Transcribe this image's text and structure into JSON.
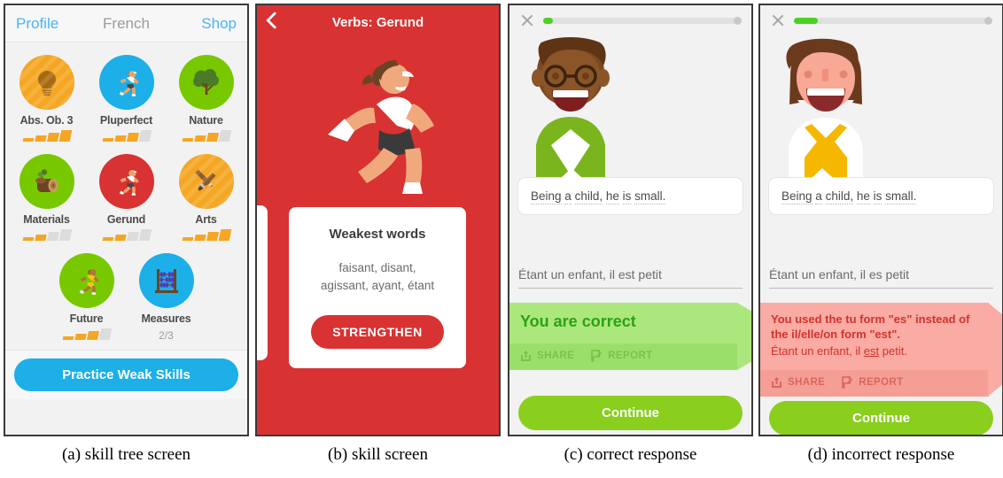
{
  "figure": {
    "captions": [
      {
        "id": "a",
        "text": "(a) skill tree screen"
      },
      {
        "id": "b",
        "text": "(b) skill screen"
      },
      {
        "id": "c",
        "text": "(c) correct response"
      },
      {
        "id": "d",
        "text": "(d) incorrect response"
      }
    ]
  },
  "colors": {
    "brand_blue": "#1cafe8",
    "brand_green": "#78c800",
    "brand_gold": "#f5a623",
    "brand_red": "#d83232",
    "correct_banner": "#ace77d",
    "correct_text": "#2aa314",
    "wrong_banner": "#f9aba4",
    "wrong_text": "#d0342c",
    "continue_green": "#8ace1e",
    "progress_green": "#4cd122"
  },
  "skill_tree": {
    "topbar": {
      "left_label": "Profile",
      "title": "French",
      "right_label": "Shop"
    },
    "rows": [
      [
        {
          "label": "Abs. Ob. 3",
          "icon": "lightbulb-icon",
          "color": "gold",
          "level": 4,
          "max": 4
        },
        {
          "label": "Pluperfect",
          "icon": "runner-icon",
          "color": "blue",
          "level": 3,
          "max": 4
        },
        {
          "label": "Nature",
          "icon": "tree-icon",
          "color": "green",
          "level": 3,
          "max": 4
        }
      ],
      [
        {
          "label": "Materials",
          "icon": "log-icon",
          "color": "green",
          "level": 2,
          "max": 4
        },
        {
          "label": "Gerund",
          "icon": "runner-icon",
          "color": "red",
          "level": 2,
          "max": 4
        },
        {
          "label": "Arts",
          "icon": "brush-pencil-icon",
          "color": "gold",
          "level": 4,
          "max": 4
        }
      ],
      [
        {
          "label": "Future",
          "icon": "runner-icon",
          "color": "green",
          "level": 3,
          "max": 4
        },
        {
          "label": "Measures",
          "icon": "abacus-icon",
          "color": "blue",
          "level": 0,
          "max": 0,
          "sub": "2/3"
        }
      ]
    ],
    "practice_button": "Practice Weak Skills"
  },
  "skill_screen": {
    "back_icon": "chevron-left-icon",
    "title": "Verbs: Gerund",
    "hero_icon": "runner-illustration",
    "card": {
      "title": "Weakest words",
      "words": "faisant, disant,\nagissant, ayant, étant",
      "words_line1": "faisant, disant,",
      "words_line2": "agissant, ayant, étant",
      "button": "STRENGTHEN"
    }
  },
  "correct_response": {
    "close_icon": "close-icon",
    "progress_percent": 5,
    "character": "boy-with-glasses-green-shirt",
    "prompt": "Being a child, he is small.",
    "prompt_words": [
      "Being",
      "a",
      "child,",
      "he",
      "is",
      "small."
    ],
    "answer": "Étant un enfant, il est petit",
    "banner_title": "You are correct",
    "actions": [
      {
        "label": "SHARE",
        "icon": "share-icon"
      },
      {
        "label": "REPORT",
        "icon": "report-flag-icon"
      }
    ],
    "continue_label": "Continue"
  },
  "incorrect_response": {
    "close_icon": "close-icon",
    "progress_percent": 12,
    "character": "girl-brown-hair-yellow-vest",
    "prompt": "Being a child, he is small.",
    "prompt_words": [
      "Being",
      "a",
      "child,",
      "he",
      "is",
      "small."
    ],
    "answer": "Étant un enfant, il es petit",
    "banner_title": "You used the tu form \"es\" instead of the il/elle/on form \"est\".",
    "banner_correction_prefix": "Étant un enfant, il ",
    "banner_correction_highlight": "est",
    "banner_correction_suffix": " petit.",
    "actions": [
      {
        "label": "SHARE",
        "icon": "share-icon"
      },
      {
        "label": "REPORT",
        "icon": "report-flag-icon"
      }
    ],
    "continue_label": "Continue"
  }
}
